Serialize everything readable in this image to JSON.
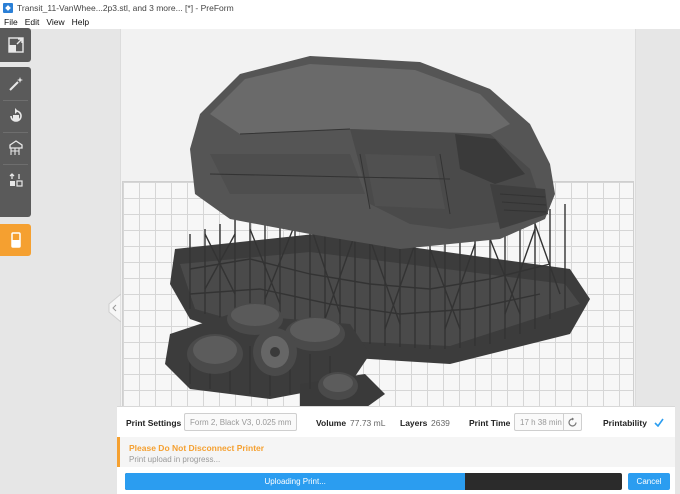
{
  "window": {
    "title": "Transit_11-VanWhee...2p3.stl, and 3 more... [*] - PreForm"
  },
  "menu": {
    "items": [
      "File",
      "Edit",
      "View",
      "Help"
    ]
  },
  "toolbar": {
    "icons": [
      "scale-icon",
      "magic-wand-icon",
      "rotate-icon",
      "supports-icon",
      "layout-icon"
    ],
    "active_icon": "print-icon",
    "accent_color": "#f5a030"
  },
  "side_tab": {
    "icon": "chevron-left-icon"
  },
  "print_panel": {
    "print_settings_label": "Print Settings",
    "print_settings_value": "Form 2, Black V3, 0.025 mm",
    "volume_label": "Volume",
    "volume_value": "77.73 mL",
    "layers_label": "Layers",
    "layers_value": "2639",
    "print_time_label": "Print Time",
    "print_time_value": "17 h 38 min",
    "printability_label": "Printability",
    "printability_icon": "checkmark-icon"
  },
  "warning": {
    "title": "Please Do Not Disconnect Printer",
    "subtitle": "Print upload in progress...",
    "color": "#f5a030"
  },
  "upload": {
    "label": "Uploading Print...",
    "progress_fraction": 0.685,
    "bar_color": "#2b9df0"
  },
  "cancel": {
    "label": "Cancel"
  }
}
